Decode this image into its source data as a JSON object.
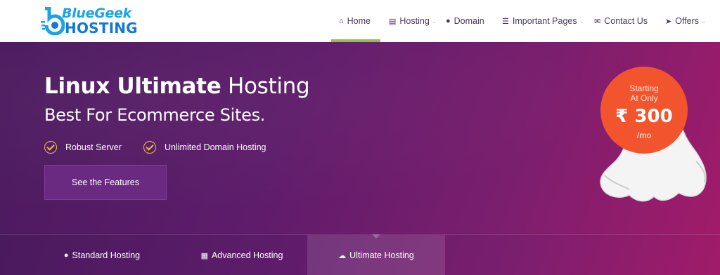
{
  "brand": {
    "line1": "BlueGeek",
    "line2": "HOSTING"
  },
  "nav": {
    "items": [
      {
        "label": "Home",
        "icon": "home-icon",
        "active": true
      },
      {
        "label": "Hosting",
        "icon": "server-list-icon",
        "has_dropdown": true
      },
      {
        "label": "Domain",
        "icon": "globe-icon"
      },
      {
        "label": "Important Pages",
        "icon": "list-icon",
        "has_dropdown": true
      },
      {
        "label": "Contact Us",
        "icon": "envelope-icon"
      },
      {
        "label": "Offers",
        "icon": "tag-icon",
        "has_dropdown": true
      }
    ],
    "active_color": "#8cc63f"
  },
  "hero": {
    "title_bold": "Linux Ultimate",
    "title_light": "Hosting",
    "subtitle": "Best For Ecommerce Sites.",
    "features": [
      "Robust Server",
      "Unlimited Domain Hosting"
    ],
    "cta_label": "See the Features",
    "price": {
      "line1": "Starting",
      "line2": "At Only",
      "amount": "₹ 300",
      "per": "/mo"
    },
    "accent_color": "#f2542d",
    "check_color": "#f0c23a"
  },
  "tabs": [
    {
      "label": "Standard Hosting",
      "icon": "globe-icon"
    },
    {
      "label": "Advanced Hosting",
      "icon": "grid-icon"
    },
    {
      "label": "Ultimate Hosting",
      "icon": "cloud-icon",
      "active": true
    }
  ]
}
